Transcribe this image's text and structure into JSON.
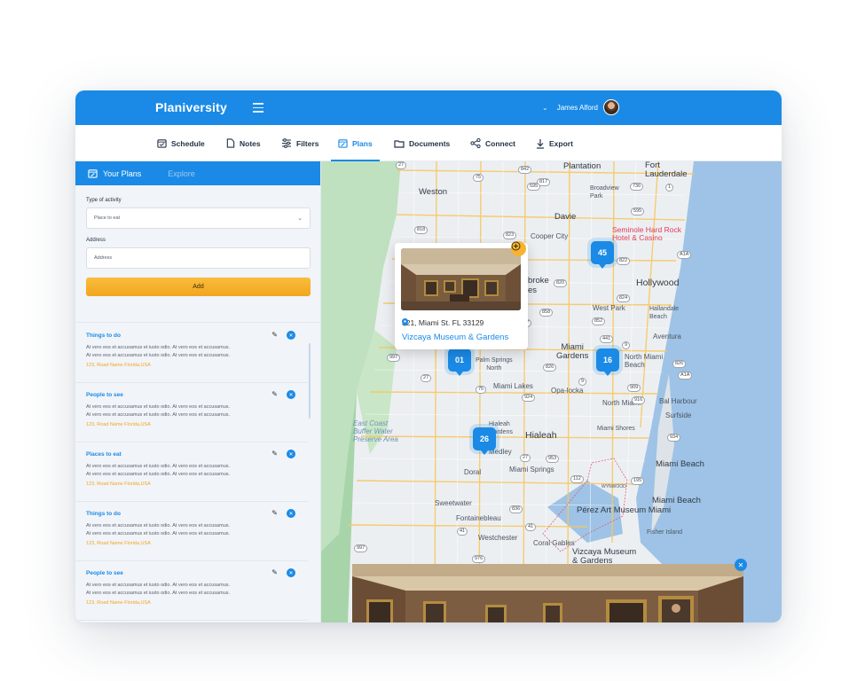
{
  "app": {
    "brand": "Planiversity",
    "user_name": "James Alford"
  },
  "nav": {
    "items": [
      {
        "label": "Schedule",
        "icon": "calendar-check-icon"
      },
      {
        "label": "Notes",
        "icon": "document-icon"
      },
      {
        "label": "Filters",
        "icon": "sliders-icon"
      },
      {
        "label": "Plans",
        "icon": "calendar-edit-icon",
        "active": true
      },
      {
        "label": "Documents",
        "icon": "folder-icon"
      },
      {
        "label": "Connect",
        "icon": "share-icon"
      },
      {
        "label": "Export",
        "icon": "download-icon"
      }
    ]
  },
  "sidebar": {
    "tab_active": "Your Plans",
    "tab_inactive": "Explore",
    "form": {
      "activity_label": "Type of activity",
      "activity_value": "Place to eat",
      "address_label": "Address",
      "address_placeholder": "Address",
      "add_button": "Add"
    },
    "plans": [
      {
        "title": "Things to do",
        "line1": "At vero eos et accusamus et iusto odio. At vero eos et accusamus.",
        "line2": "At vero eos et accusamus et iusto odio. At vero eos et accusamus.",
        "address": "123, Road Name Florida,USA"
      },
      {
        "title": "People to see",
        "line1": "At vero eos et accusamus et iusto odio. At vero eos et accusamus.",
        "line2": "At vero eos et accusamus et iusto odio. At vero eos et accusamus.",
        "address": "123, Road Name Florida,USA"
      },
      {
        "title": "Places to eat",
        "line1": "At vero eos et accusamus et iusto odio. At vero eos et accusamus.",
        "line2": "At vero eos et accusamus et iusto odio. At vero eos et accusamus.",
        "address": "123, Road Name Florida,USA"
      },
      {
        "title": "Things to do",
        "line1": "At vero eos et accusamus et iusto odio. At vero eos et accusamus.",
        "line2": "At vero eos et accusamus et iusto odio. At vero eos et accusamus.",
        "address": "123, Road Name Florida,USA"
      },
      {
        "title": "People to see",
        "line1": "At vero eos et accusamus et iusto odio. At vero eos et accusamus.",
        "line2": "At vero eos et accusamus et iusto odio. At vero eos et accusamus.",
        "address": "123, Road Name Florida,USA"
      }
    ]
  },
  "map": {
    "clusters": [
      "45",
      "01",
      "16",
      "26"
    ],
    "popup": {
      "address": "321, Miami St. FL 33129",
      "name": "Vizcaya Museum & Gardens"
    },
    "places": {
      "plantation": "Plantation",
      "fort_lauderdale": "Fort\nLauderdale",
      "weston": "Weston",
      "broadview_park": "Broadview\nPark",
      "davie": "Davie",
      "cooper_city": "Cooper City",
      "seminole": "Seminole Hard Rock\nHotel & Casino",
      "hollywood": "Hollywood",
      "pembroke": "broke",
      "pines": "es",
      "west_park": "West Park",
      "hallandale": "Hallandale\nBeach",
      "aventura": "Aventura",
      "miami_gardens": "Miami\nGardens",
      "north_miami_beach": "North Miami\nBeach",
      "palm_springs": "Palm Springs\nNorth",
      "miami_lakes": "Miami Lakes",
      "opa_locka": "Opa-locka",
      "bal_harbour": "Bal Harbour",
      "north_miami": "North Miami",
      "surfside": "Surfside",
      "hialeah_gardens": "Hialeah\nGardens",
      "hialeah": "Hialeah",
      "miami_shores": "Miami Shores",
      "east_coast": "East Coast\nBuffer Water\nPreserve Area",
      "medley": "Medley",
      "doral": "Doral",
      "miami_springs": "Miami Springs",
      "miami_beach": "Miami Beach",
      "wynwood": "WYNWOOD",
      "sweetwater": "Sweetwater",
      "miami_beach_2": "Miami Beach",
      "perez": "Pérez Art Museum Miami",
      "fontainebleau": "Fontainebleau",
      "fisher_island": "Fisher Island",
      "westchester": "Westchester",
      "coral_gables": "Coral Gables",
      "vizcaya": "Vizcaya Museum\n& Gardens"
    },
    "shields": [
      "27",
      "842",
      "817",
      "75",
      "595",
      "736",
      "1",
      "595",
      "818",
      "823",
      "A1A",
      "822",
      "820",
      "824",
      "858",
      "852",
      "817",
      "441",
      "9",
      "997",
      "826",
      "27",
      "826",
      "A1A",
      "909",
      "916",
      "75",
      "924",
      "9",
      "934",
      "27",
      "953",
      "112",
      "195",
      "836",
      "41",
      "41",
      "976",
      "997"
    ]
  },
  "colors": {
    "primary": "#1a8ae6",
    "accent": "#f2a51f",
    "water": "#9ec3e6",
    "park": "#bfe1c0"
  }
}
